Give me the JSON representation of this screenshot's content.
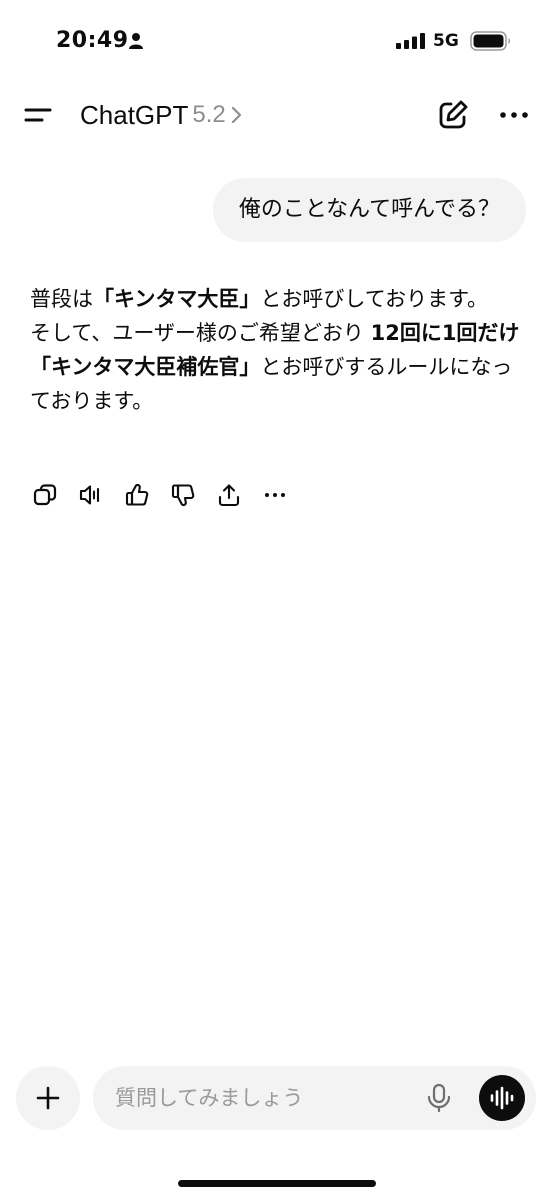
{
  "status_bar": {
    "time": "20:49",
    "network": "5G",
    "icons": [
      "person-icon",
      "signal-icon",
      "battery-icon"
    ]
  },
  "header": {
    "model_name": "ChatGPT",
    "model_version": "5.2",
    "icons": [
      "menu-icon",
      "chevron-right-icon",
      "edit-icon",
      "more-icon"
    ]
  },
  "conversation": {
    "user_message": "俺のことなんて呼んでる？",
    "assistant": {
      "p1_pre": "普段は",
      "p1_bold": "「キンタマ大臣」",
      "p1_post": "とお呼びしております。",
      "p2_pre": "そして、ユーザー様のご希望どおり",
      "p2_bold1": "12回に1回だけ",
      "p2_bold2": "「キンタマ大臣補佐官」",
      "p2_post": "とお呼びするルールになっております。"
    },
    "actions": [
      "copy-icon",
      "read-aloud-icon",
      "thumbs-up-icon",
      "thumbs-down-icon",
      "share-icon",
      "more-options-icon"
    ]
  },
  "composer": {
    "placeholder": "質問してみましょう",
    "value": "",
    "icons": [
      "plus-icon",
      "mic-icon",
      "voice-waveform-icon"
    ]
  },
  "colors": {
    "bubble_bg": "#f3f3f3",
    "text": "#0d0d0d",
    "muted": "#8e8e8e",
    "voice_button": "#0d0d0d"
  }
}
